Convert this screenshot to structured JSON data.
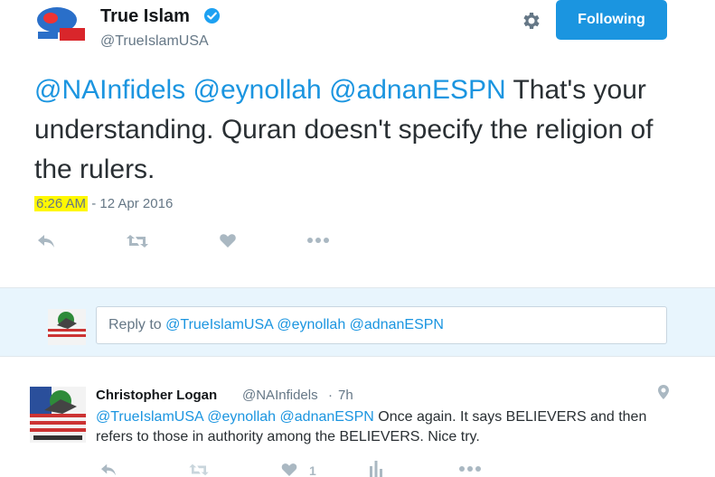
{
  "colors": {
    "accent": "#1b95e0",
    "highlight": "#fff800",
    "muted": "#657786",
    "icon": "#aab8c2"
  },
  "main_tweet": {
    "author": "True Islam",
    "handle": "@TrueIslamUSA",
    "follow_label": "Following",
    "text": {
      "mentions": [
        "@NAInfidels",
        "@eynollah",
        "@adnanESPN"
      ],
      "body": "That's your understanding. Quran doesn't specify the religion of the rulers."
    },
    "time": "6:26 AM",
    "date_suffix": " - 12 Apr 2016",
    "actions": [
      "reply-icon",
      "retweet-icon",
      "like-icon",
      "more-icon"
    ]
  },
  "reply_box": {
    "prefix": "Reply to ",
    "mentions": "@TrueIslamUSA @eynollah @adnanESPN"
  },
  "reply_tweet": {
    "author": "Christopher Logan",
    "handle": "@NAInfidels",
    "separator": "·",
    "time": "7h",
    "mentions": "@TrueIslamUSA @eynollah @adnanESPN",
    "body": " Once again. It says BELIEVERS and then refers to those in authority among the BELIEVERS. Nice try.",
    "like_count": "1"
  }
}
